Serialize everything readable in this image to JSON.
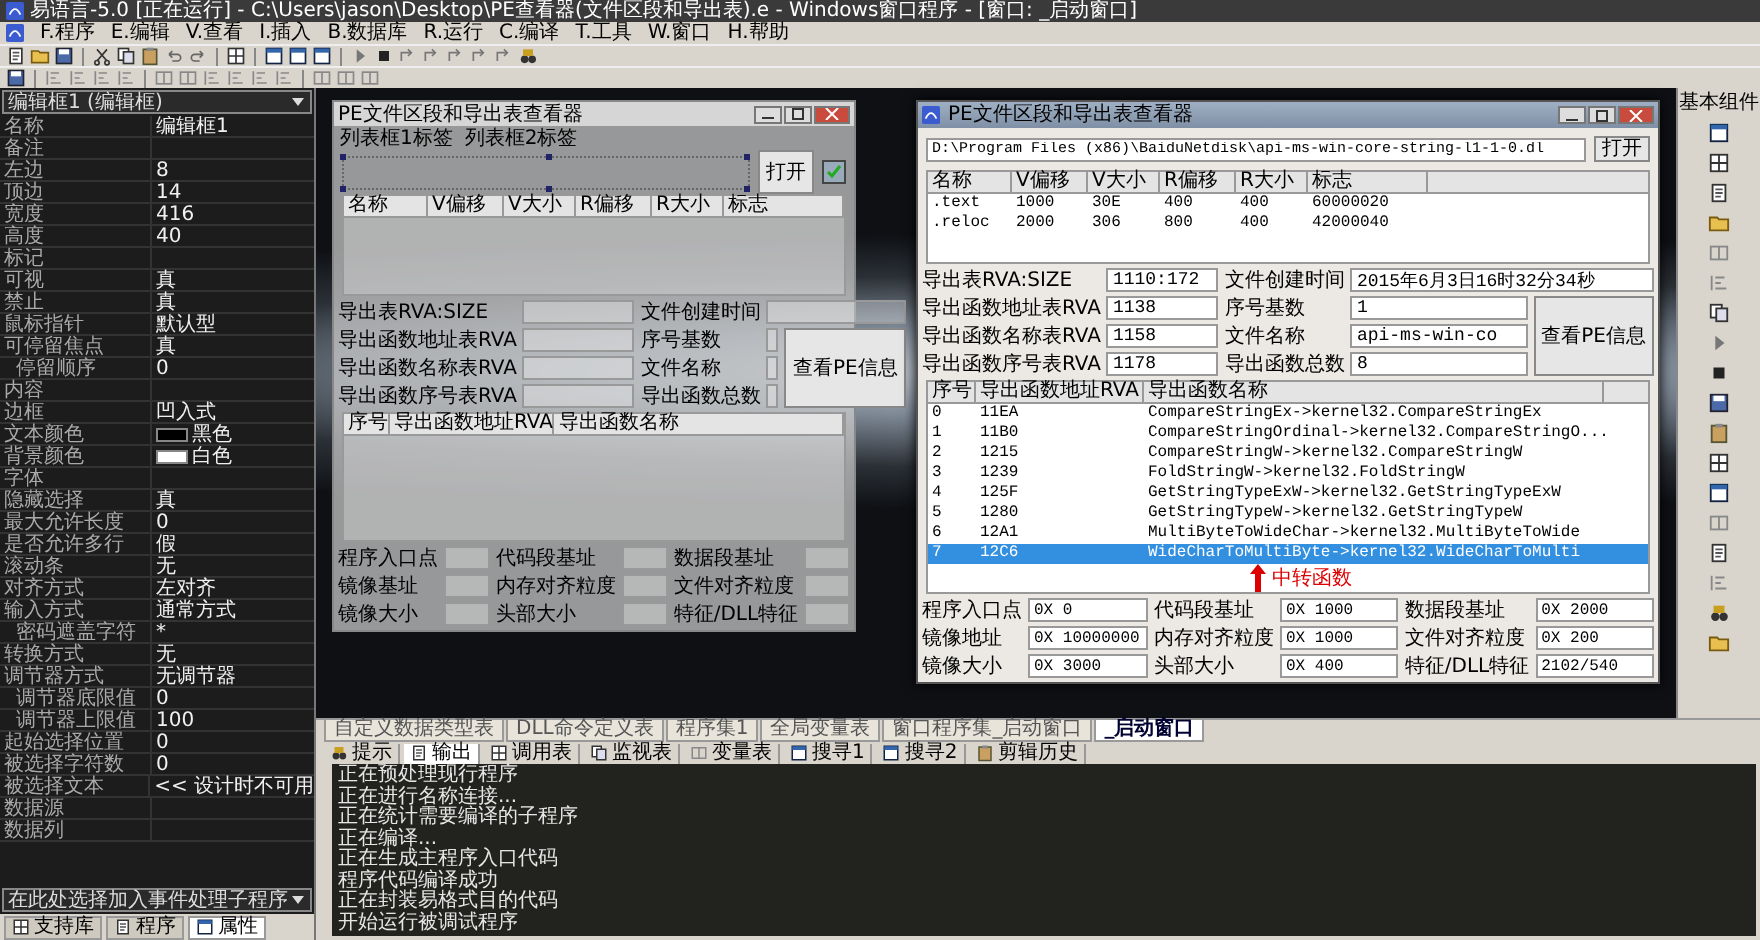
{
  "window": {
    "title": "易语言-5.0 [正在运行] - C:\\Users\\jason\\Desktop\\PE查看器(文件区段和导出表).e - Windows窗口程序 - [窗口: _启动窗口]"
  },
  "menu": [
    "F.程序",
    "E.编辑",
    "V.查看",
    "I.插入",
    "B.数据库",
    "R.运行",
    "C.编译",
    "T.工具",
    "W.窗口",
    "H.帮助"
  ],
  "property_panel": {
    "object": "编辑框1 (编辑框)",
    "properties": [
      {
        "name": "名称",
        "value": "编辑框1"
      },
      {
        "name": "备注"
      },
      {
        "name": "左边",
        "value": "8"
      },
      {
        "name": "顶边",
        "value": "14"
      },
      {
        "name": "宽度",
        "value": "416"
      },
      {
        "name": "高度",
        "value": "40"
      },
      {
        "name": "标记"
      },
      {
        "name": "可视",
        "value": "真"
      },
      {
        "name": "禁止",
        "value": "真"
      },
      {
        "name": "鼠标指针",
        "value": "默认型"
      },
      {
        "name": "可停留焦点",
        "value": "真"
      },
      {
        "name": "停留顺序",
        "value": "0",
        "indented": true
      },
      {
        "name": "内容"
      },
      {
        "name": "边框",
        "value": "凹入式"
      },
      {
        "name": "文本颜色",
        "value": "黑色",
        "color": "#000000"
      },
      {
        "name": "背景颜色",
        "value": "白色",
        "color": "#ffffff"
      },
      {
        "name": "字体"
      },
      {
        "name": "隐藏选择",
        "value": "真"
      },
      {
        "name": "最大允许长度",
        "value": "0"
      },
      {
        "name": "是否允许多行",
        "value": "假"
      },
      {
        "name": "滚动条",
        "value": "无"
      },
      {
        "name": "对齐方式",
        "value": "左对齐"
      },
      {
        "name": "输入方式",
        "value": "通常方式"
      },
      {
        "name": "密码遮盖字符",
        "value": "*",
        "indented": true
      },
      {
        "name": "转换方式",
        "value": "无"
      },
      {
        "name": "调节器方式",
        "value": "无调节器"
      },
      {
        "name": "调节器底限值",
        "value": "0",
        "indented": true
      },
      {
        "name": "调节器上限值",
        "value": "100",
        "indented": true
      },
      {
        "name": "起始选择位置",
        "value": "0"
      },
      {
        "name": "被选择字符数",
        "value": "0"
      },
      {
        "name": "被选择文本",
        "value": "<< 设计时不可用"
      },
      {
        "name": "数据源"
      },
      {
        "name": "数据列"
      }
    ],
    "event_selector": "在此处选择加入事件处理子程序",
    "tabs": [
      {
        "label": "支持库",
        "selected": false
      },
      {
        "label": "程序",
        "selected": false
      },
      {
        "label": "属性",
        "selected": true
      }
    ]
  },
  "designer_form": {
    "title": "PE文件区段和导出表查看器",
    "menu": [
      "列表框1标签",
      "列表框2标签"
    ],
    "open_button": "打开",
    "section_columns": [
      "名称",
      "V偏移",
      "V大小",
      "R偏移",
      "R大小",
      "标志"
    ],
    "pe_fields": [
      {
        "label": "导出表RVA:SIZE"
      },
      {
        "label": "文件创建时间"
      },
      {
        "label": "导出函数地址表RVA"
      },
      {
        "label": "序号基数"
      },
      {
        "label": "导出函数名称表RVA"
      },
      {
        "label": "文件名称"
      },
      {
        "label": "导出函数序号表RVA"
      },
      {
        "label": "导出函数总数"
      }
    ],
    "info_button": "查看PE信息",
    "export_columns": [
      "序号",
      "导出函数地址RVA",
      "导出函数名称"
    ],
    "header_fields": [
      {
        "label": "程序入口点"
      },
      {
        "label": "代码段基址"
      },
      {
        "label": "数据段基址"
      },
      {
        "label": "镜像基址"
      },
      {
        "label": "内存对齐粒度"
      },
      {
        "label": "文件对齐粒度"
      },
      {
        "label": "镜像大小"
      },
      {
        "label": "头部大小"
      },
      {
        "label": "特征/DLL特征"
      }
    ]
  },
  "running_dialog": {
    "title": "PE文件区段和导出表查看器",
    "path": "D:\\Program Files (x86)\\BaiduNetdisk\\api-ms-win-core-string-l1-1-0.dl",
    "open_button": "打开",
    "section_columns": [
      "名称",
      "V偏移",
      "V大小",
      "R偏移",
      "R大小",
      "标志"
    ],
    "sections": [
      [
        ".text",
        "1000",
        "30E",
        "400",
        "400",
        "60000020"
      ],
      [
        ".reloc",
        "2000",
        "306",
        "800",
        "400",
        "42000040"
      ]
    ],
    "pe_fields": [
      {
        "label": "导出表RVA:SIZE",
        "value": "1110:172"
      },
      {
        "label": "文件创建时间",
        "value": "2015年6月3日16时32分34秒"
      },
      {
        "label": "导出函数地址表RVA",
        "value": "1138"
      },
      {
        "label": "序号基数",
        "value": "1"
      },
      {
        "label": "导出函数名称表RVA",
        "value": "1158"
      },
      {
        "label": "文件名称",
        "value": "api-ms-win-co"
      },
      {
        "label": "导出函数序号表RVA",
        "value": "1178"
      },
      {
        "label": "导出函数总数",
        "value": "8"
      }
    ],
    "info_button": "查看PE信息",
    "export_columns": [
      "序号",
      "导出函数地址RVA",
      "导出函数名称"
    ],
    "exports": [
      {
        "cells": [
          "0",
          "11EA",
          "CompareStringEx->kernel32.CompareStringEx"
        ],
        "selected": false
      },
      {
        "cells": [
          "1",
          "11B0",
          "CompareStringOrdinal->kernel32.CompareStringO..."
        ],
        "selected": false
      },
      {
        "cells": [
          "2",
          "1215",
          "CompareStringW->kernel32.CompareStringW"
        ],
        "selected": false
      },
      {
        "cells": [
          "3",
          "1239",
          "FoldStringW->kernel32.FoldStringW"
        ],
        "selected": false
      },
      {
        "cells": [
          "4",
          "125F",
          "GetStringTypeExW->kernel32.GetStringTypeExW"
        ],
        "selected": false
      },
      {
        "cells": [
          "5",
          "1280",
          "GetStringTypeW->kernel32.GetStringTypeW"
        ],
        "selected": false
      },
      {
        "cells": [
          "6",
          "12A1",
          "MultiByteToWideChar->kernel32.MultiByteToWide"
        ],
        "selected": false
      },
      {
        "cells": [
          "7",
          "12C6",
          "WideCharToMultiByte->kernel32.WideCharToMulti"
        ],
        "selected": true
      }
    ],
    "annotation": "中转函数",
    "header_fields": [
      {
        "label": "程序入口点",
        "value": "0X 0"
      },
      {
        "label": "代码段基址",
        "value": "0X 1000"
      },
      {
        "label": "数据段基址",
        "value": "0X 2000"
      },
      {
        "label": "镜像地址",
        "value": "0X 10000000"
      },
      {
        "label": "内存对齐粒度",
        "value": "0X 1000"
      },
      {
        "label": "文件对齐粒度",
        "value": "0X 200"
      },
      {
        "label": "镜像大小",
        "value": "0X 3000"
      },
      {
        "label": "头部大小",
        "value": "0X 400"
      },
      {
        "label": "特征/DLL特征",
        "value": "2102/540"
      }
    ]
  },
  "component_panel": {
    "title": "基本组件"
  },
  "editor_tabs": [
    {
      "label": "自定义数据类型表",
      "selected": false
    },
    {
      "label": "DLL命令定义表",
      "selected": false
    },
    {
      "label": "程序集1",
      "selected": false
    },
    {
      "label": "全局变量表",
      "selected": false
    },
    {
      "label": "窗口程序集_启动窗口",
      "selected": false
    },
    {
      "label": "_启动窗口",
      "selected": true
    }
  ],
  "output_panel": {
    "tabs": [
      {
        "label": "提示",
        "selected": false
      },
      {
        "label": "输出",
        "selected": true
      },
      {
        "label": "调用表",
        "selected": false
      },
      {
        "label": "监视表",
        "selected": false
      },
      {
        "label": "变量表",
        "selected": false
      },
      {
        "label": "搜寻1",
        "selected": false
      },
      {
        "label": "搜寻2",
        "selected": false
      },
      {
        "label": "剪辑历史",
        "selected": false
      }
    ],
    "lines": [
      "正在预处理现行程序",
      "正在进行名称连接...",
      "正在统计需要编译的子程序",
      "正在编译...",
      "正在生成主程序入口代码",
      "程序代码编译成功",
      "正在封装易格式目的代码",
      "开始运行被调试程序"
    ]
  }
}
